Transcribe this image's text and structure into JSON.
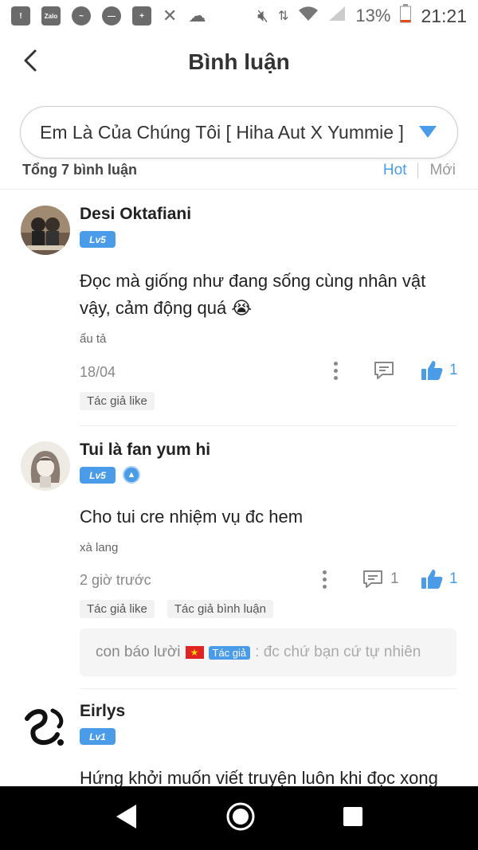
{
  "status": {
    "zalo_label": "Zalo",
    "battery": "13%",
    "time": "21:21"
  },
  "header": {
    "title": "Bình luận"
  },
  "selector": {
    "value": "Em Là Của Chúng Tôi [ Hiha Aut X Yummie ]"
  },
  "filter": {
    "total": "Tổng 7 bình luận",
    "sort_hot": "Hot",
    "sort_new": "Mới",
    "accent": "#4a9be8"
  },
  "comments": [
    {
      "name": "Desi Oktafiani",
      "level": "Lv5",
      "text": "Đọc mà giống như đang sống cùng nhân vật vậy, cảm động quá 😭",
      "sub": "ẩu tả",
      "date": "18/04",
      "likes": "1",
      "tags": [
        "Tác giả like"
      ]
    },
    {
      "name": "Tui là fan yum hi",
      "level": "Lv5",
      "text": "Cho tui cre nhiệm vụ đc hem",
      "sub": "xà lang",
      "date": "2 giờ trước",
      "replies": "1",
      "likes": "1",
      "tags": [
        "Tác giả like",
        "Tác giả bình luận"
      ],
      "reply": {
        "author": "con báo lười",
        "badge": "Tác giả",
        "text": ": đc chứ bạn cứ tự nhiên"
      }
    },
    {
      "name": "Eirlys",
      "level": "Lv1",
      "text": "Hứng khởi muốn viết truyện luôn khi đọc xong"
    }
  ]
}
